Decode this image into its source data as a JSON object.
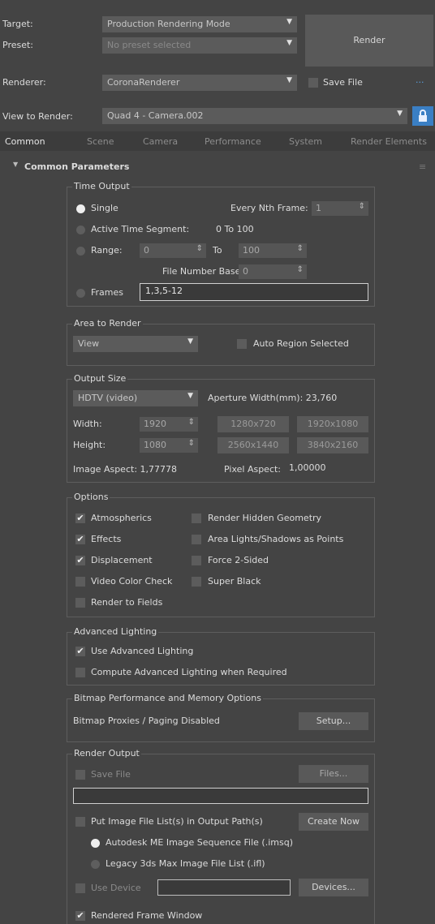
{
  "header": {
    "target_label": "Target:",
    "target_value": "Production Rendering Mode",
    "preset_label": "Preset:",
    "preset_value": "No preset selected",
    "renderer_label": "Renderer:",
    "renderer_value": "CoronaRenderer",
    "render_button": "Render",
    "save_file_label": "Save File",
    "more_button": "...",
    "view_label": "View to Render:",
    "view_value": "Quad 4 - Camera.002"
  },
  "tabs": [
    {
      "label": "Common",
      "active": true
    },
    {
      "label": "Scene",
      "active": false
    },
    {
      "label": "Camera",
      "active": false
    },
    {
      "label": "Performance",
      "active": false
    },
    {
      "label": "System",
      "active": false
    },
    {
      "label": "Render Elements",
      "active": false
    }
  ],
  "rollout": {
    "title": "Common Parameters"
  },
  "time_output": {
    "title": "Time Output",
    "single": "Single",
    "every_nth_label": "Every Nth Frame:",
    "every_nth_value": "1",
    "active_segment": "Active Time Segment:",
    "active_segment_value": "0 To 100",
    "range": "Range:",
    "range_from": "0",
    "range_to_label": "To",
    "range_to": "100",
    "file_number_base_label": "File Number Base:",
    "file_number_base_value": "0",
    "frames": "Frames",
    "frames_value": "1,3,5-12"
  },
  "area_to_render": {
    "title": "Area to Render",
    "value": "View",
    "auto_region": "Auto Region Selected"
  },
  "output_size": {
    "title": "Output Size",
    "preset": "HDTV (video)",
    "aperture": "Aperture Width(mm): 23,760",
    "width_label": "Width:",
    "width_value": "1920",
    "height_label": "Height:",
    "height_value": "1080",
    "presets": [
      "1280x720",
      "1920x1080",
      "2560x1440",
      "3840x2160"
    ],
    "image_aspect": "Image Aspect: 1,77778",
    "pixel_aspect_label": "Pixel Aspect:",
    "pixel_aspect_value": "1,00000"
  },
  "options": {
    "title": "Options",
    "left": [
      {
        "label": "Atmospherics",
        "checked": true
      },
      {
        "label": "Effects",
        "checked": true
      },
      {
        "label": "Displacement",
        "checked": true
      },
      {
        "label": "Video Color Check",
        "checked": false
      },
      {
        "label": "Render to Fields",
        "checked": false
      }
    ],
    "right": [
      {
        "label": "Render Hidden Geometry",
        "checked": false
      },
      {
        "label": "Area Lights/Shadows as Points",
        "checked": false
      },
      {
        "label": "Force 2-Sided",
        "checked": false
      },
      {
        "label": "Super Black",
        "checked": false
      }
    ]
  },
  "advanced_lighting": {
    "title": "Advanced Lighting",
    "use": "Use Advanced Lighting",
    "compute": "Compute Advanced Lighting when Required"
  },
  "bitmap": {
    "title": "Bitmap Performance and Memory Options",
    "status": "Bitmap Proxies / Paging Disabled",
    "setup": "Setup..."
  },
  "render_output": {
    "title": "Render Output",
    "save_file": "Save File",
    "files": "Files...",
    "put_image": "Put Image File List(s) in Output Path(s)",
    "create_now": "Create Now",
    "autodesk": "Autodesk ME Image Sequence File (.imsq)",
    "legacy": "Legacy 3ds Max Image File List (.ifl)",
    "use_device": "Use Device",
    "devices": "Devices...",
    "rendered_frame": "Rendered Frame Window"
  }
}
